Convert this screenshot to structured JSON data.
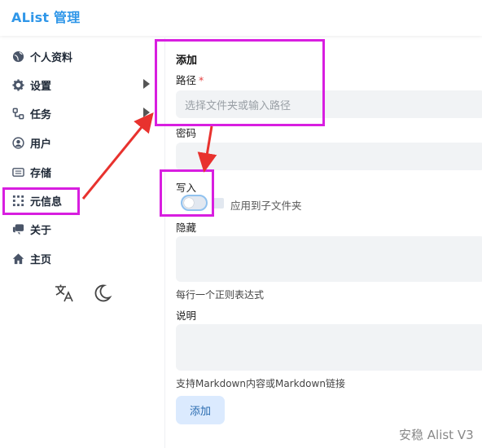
{
  "header": {
    "logo": "AList 管理"
  },
  "sidebar": {
    "items": [
      {
        "label": "个人资料",
        "icon": "globe-icon",
        "has_submenu": false
      },
      {
        "label": "设置",
        "icon": "gear-icon",
        "has_submenu": true
      },
      {
        "label": "任务",
        "icon": "tasks-icon",
        "has_submenu": true
      },
      {
        "label": "用户",
        "icon": "user-circle-icon",
        "has_submenu": false
      },
      {
        "label": "存储",
        "icon": "storage-icon",
        "has_submenu": false
      },
      {
        "label": "元信息",
        "icon": "meta-grid-icon",
        "has_submenu": false
      },
      {
        "label": "关于",
        "icon": "chat-icon",
        "has_submenu": false
      },
      {
        "label": "主页",
        "icon": "home-icon",
        "has_submenu": false
      }
    ],
    "bottom": {
      "language_icon": "translate-icon",
      "theme_icon": "moon-icon"
    }
  },
  "form": {
    "title": "添加",
    "path": {
      "label": "路径",
      "required_mark": "*",
      "placeholder": "选择文件夹或输入路径",
      "value": ""
    },
    "password": {
      "label": "密码",
      "value": ""
    },
    "write": {
      "label": "写入",
      "enabled": false,
      "apply_sub_label": "应用到子文件夹",
      "apply_sub_checked": false
    },
    "hide": {
      "label": "隐藏",
      "value": "",
      "hint": "每行一个正则表达式"
    },
    "readme": {
      "label": "说明",
      "value": "",
      "hint": "支持Markdown内容或Markdown链接"
    },
    "submit_label": "添加"
  },
  "watermark": "安稳 Alist V3",
  "colors": {
    "accent": "#2f96e8",
    "highlight": "#d81ee0",
    "arrow": "#e8322e"
  }
}
